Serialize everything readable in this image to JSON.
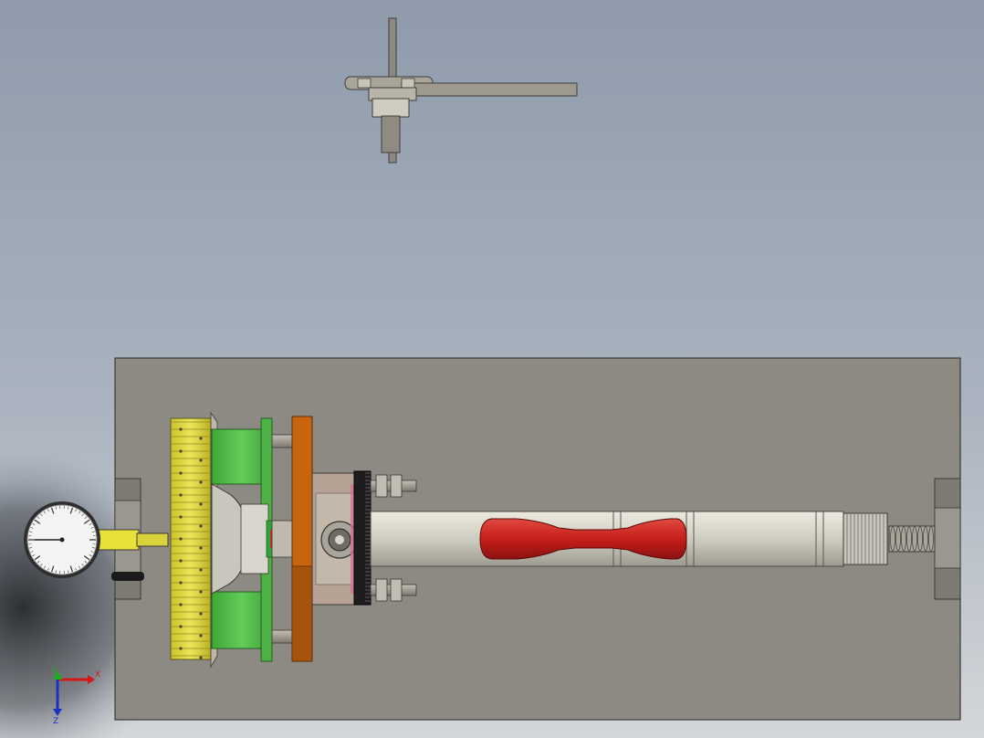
{
  "viewport": {
    "background_top": "#9eaab8",
    "background_bottom": "#c9cdd2",
    "shadow_color": "#2a2d31"
  },
  "colors": {
    "base_plate": "#8d8a84",
    "gear_yellow": "#d8d230",
    "housing_green": "#56c04e",
    "flange_orange": "#c8640e",
    "specimen_red": "#c8201e",
    "shaft_gray": "#d6d4c8",
    "metal": "#a8a49a",
    "dark_metal": "#5a5752"
  },
  "triad": {
    "x_label": "X",
    "y_label": "Y",
    "z_label": "Z"
  }
}
